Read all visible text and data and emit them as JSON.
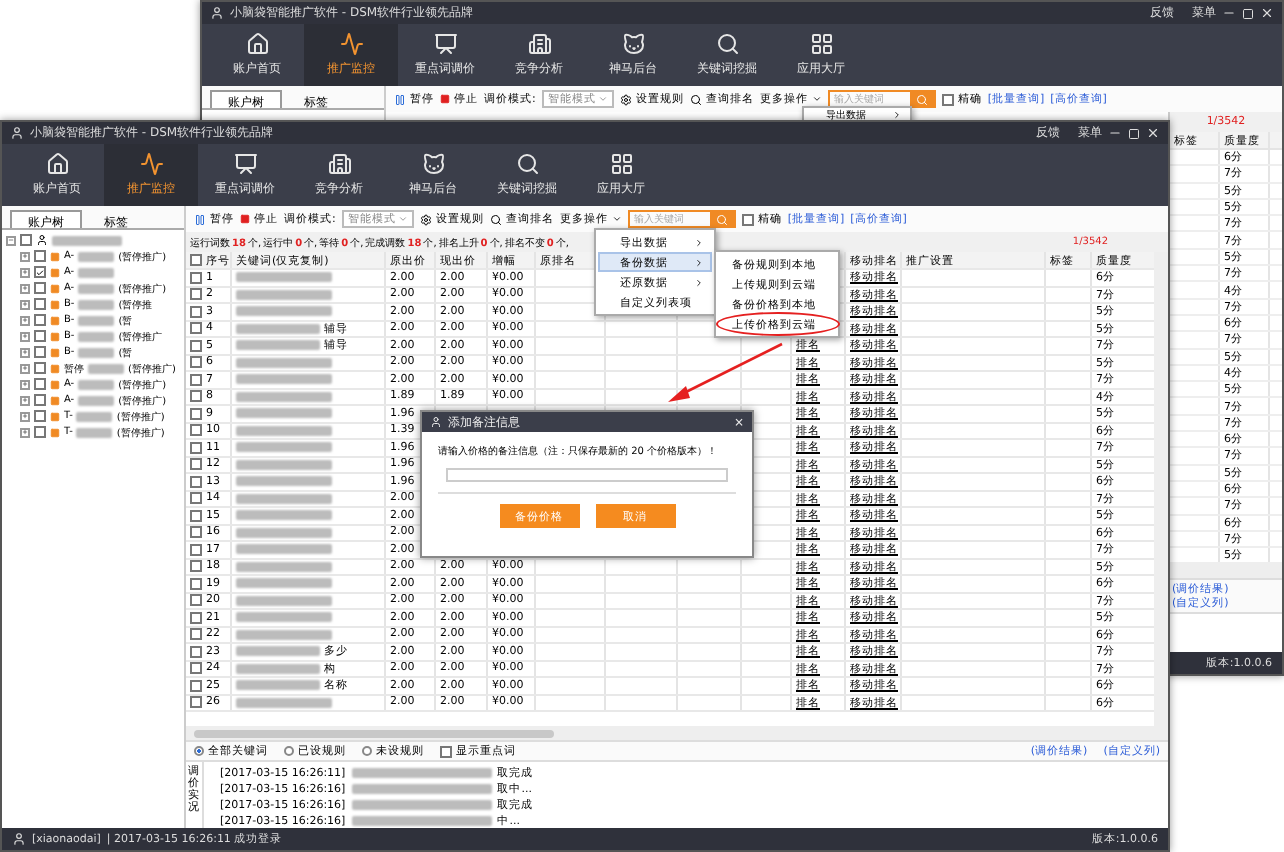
{
  "back_window": {
    "title": "小脑袋智能推广软件 - DSM软件行业领先品牌",
    "header_links": [
      "反馈",
      "菜单"
    ],
    "nav": [
      {
        "label": "账户首页",
        "selected": false
      },
      {
        "label": "推广监控",
        "selected": true
      },
      {
        "label": "重点词调价",
        "selected": false
      },
      {
        "label": "竞争分析",
        "selected": false
      },
      {
        "label": "神马后台",
        "selected": false
      },
      {
        "label": "关键词挖掘",
        "selected": false
      },
      {
        "label": "应用大厅",
        "selected": false
      }
    ],
    "tabs": [
      {
        "label": "账户树",
        "selected": true
      },
      {
        "label": "标签",
        "selected": false
      }
    ],
    "toolbar": {
      "pause": "暂停",
      "stop": "停止",
      "mode_label": "调价模式:",
      "mode": "智能模式",
      "rules": "设置规则",
      "query": "查询排名",
      "more": "更多操作",
      "search_placeholder": "输入关键词",
      "exact": {
        "label": "精确",
        "checked": false
      },
      "links": [
        "[批量查询]",
        "[高价查询]"
      ]
    },
    "menu_peek": "导出数据",
    "pager": "1/3542",
    "strip": {
      "columns": [
        "标签",
        "质量度"
      ],
      "values": [
        "6分",
        "7分",
        "5分",
        "5分",
        "7分",
        "7分",
        "5分",
        "7分",
        "4分",
        "7分",
        "6分",
        "7分",
        "5分",
        "4分",
        "5分",
        "7分",
        "7分",
        "6分",
        "7分",
        "5分",
        "6分",
        "7分",
        "6分",
        "7分",
        "5分"
      ]
    },
    "links": [
      "(调价结果)",
      "(自定义列)"
    ],
    "version": "版本:1.0.0.6"
  },
  "window": {
    "title": "小脑袋智能推广软件 - DSM软件行业领先品牌",
    "header_links": [
      "反馈",
      "菜单"
    ],
    "nav": [
      {
        "label": "账户首页",
        "selected": false
      },
      {
        "label": "推广监控",
        "selected": true
      },
      {
        "label": "重点词调价",
        "selected": false
      },
      {
        "label": "竞争分析",
        "selected": false
      },
      {
        "label": "神马后台",
        "selected": false
      },
      {
        "label": "关键词挖掘",
        "selected": false
      },
      {
        "label": "应用大厅",
        "selected": false
      }
    ],
    "tabs": [
      {
        "label": "账户树",
        "selected": true
      },
      {
        "label": "标签",
        "selected": false
      }
    ],
    "tree": {
      "expanded": true,
      "checked": false,
      "children": [
        {
          "prefix": "A-",
          "suffix": "(暂停推广)",
          "checked": false
        },
        {
          "prefix": "A-",
          "checked": true
        },
        {
          "prefix": "A-",
          "suffix": "(暂停推广)",
          "checked": false
        },
        {
          "prefix": "B-",
          "suffix": "(暂停推",
          "checked": false
        },
        {
          "prefix": "B-",
          "suffix": "(暂",
          "checked": false
        },
        {
          "prefix": "B-",
          "suffix": "(暂停推广",
          "checked": false
        },
        {
          "prefix": "B-",
          "suffix": "(暂",
          "checked": false
        },
        {
          "prefix": "暂停",
          "suffix": "(暂停推广)",
          "checked": false
        },
        {
          "prefix": "A-",
          "suffix": "(暂停推广)",
          "checked": false
        },
        {
          "prefix": "A-",
          "suffix": "(暂停推广)",
          "checked": false
        },
        {
          "prefix": "T-",
          "suffix": "(暂停推广)",
          "checked": false
        },
        {
          "prefix": "T-",
          "suffix": "(暂停推广)",
          "checked": false
        }
      ]
    },
    "toolbar": {
      "pause": "暂停",
      "stop": "停止",
      "mode_label": "调价模式:",
      "mode": "智能模式",
      "rules": "设置规则",
      "query": "查询排名",
      "more": "更多操作",
      "search_placeholder": "输入关键词",
      "exact": {
        "label": "精确",
        "checked": false
      },
      "links": [
        "[批量查询]",
        "[高价查询]"
      ]
    },
    "counts": [
      {
        "label": "运行词数",
        "value": "18",
        "unit": "个,"
      },
      {
        "label": "运行中",
        "value": "0",
        "unit": "个,"
      },
      {
        "label": "等待",
        "value": "0",
        "unit": "个,"
      },
      {
        "label": "完成调数",
        "value": "18",
        "unit": "个,"
      },
      {
        "label": "排名上升",
        "value": "0",
        "unit": "个,"
      },
      {
        "label": "排名不变",
        "value": "0",
        "unit": "个,"
      }
    ],
    "pager": "1/3542",
    "select_all": {
      "checked": false
    },
    "columns": [
      {
        "label": "序号"
      },
      {
        "label": "关键词(仅克复制)"
      },
      {
        "label": "原出价"
      },
      {
        "label": "现出价"
      },
      {
        "label": "增幅"
      },
      {
        "label": "原排名"
      },
      {},
      {},
      {},
      {},
      {
        "label": "移动排名"
      },
      {
        "label": "推广设置"
      },
      {
        "label": "标签"
      },
      {
        "label": "质量度"
      }
    ],
    "rows": [
      {
        "no": "1",
        "old": "2.00",
        "new": "2.00",
        "change": "¥0.00",
        "mobile": "移动排名",
        "quality": "6分",
        "checked": false
      },
      {
        "no": "2",
        "old": "2.00",
        "new": "2.00",
        "change": "¥0.00",
        "mobile": "移动排名",
        "quality": "7分",
        "checked": false
      },
      {
        "no": "3",
        "old": "2.00",
        "new": "2.00",
        "change": "¥0.00",
        "mobile": "移动排名",
        "quality": "5分",
        "checked": false
      },
      {
        "no": "4",
        "keyword": "辅导",
        "old": "2.00",
        "new": "2.00",
        "change": "¥0.00",
        "mobile": "移动排名",
        "quality": "5分",
        "checked": false
      },
      {
        "no": "5",
        "keyword": "辅导",
        "old": "2.00",
        "new": "2.00",
        "change": "¥0.00",
        "rank": "排名",
        "mobile": "移动排名",
        "quality": "7分",
        "checked": false
      },
      {
        "no": "6",
        "old": "2.00",
        "new": "2.00",
        "change": "¥0.00",
        "rank": "排名",
        "mobile": "移动排名",
        "quality": "5分",
        "checked": false
      },
      {
        "no": "7",
        "old": "2.00",
        "new": "2.00",
        "change": "¥0.00",
        "rank": "排名",
        "mobile": "移动排名",
        "quality": "7分",
        "checked": false
      },
      {
        "no": "8",
        "old": "1.89",
        "new": "1.89",
        "change": "¥0.00",
        "rank": "排名",
        "mobile": "移动排名",
        "quality": "4分",
        "checked": false
      },
      {
        "no": "9",
        "old": "1.96",
        "rank": "排名",
        "mobile": "移动排名",
        "quality": "5分",
        "checked": false
      },
      {
        "no": "10",
        "old": "1.39",
        "rank": "排名",
        "mobile": "移动排名",
        "quality": "6分",
        "checked": false
      },
      {
        "no": "11",
        "old": "1.96",
        "rank": "排名",
        "mobile": "移动排名",
        "quality": "7分",
        "checked": false
      },
      {
        "no": "12",
        "old": "1.96",
        "rank": "排名",
        "mobile": "移动排名",
        "quality": "5分",
        "checked": false
      },
      {
        "no": "13",
        "old": "1.96",
        "rank": "排名",
        "mobile": "移动排名",
        "quality": "6分",
        "checked": false
      },
      {
        "no": "14",
        "old": "2.00",
        "rank": "排名",
        "mobile": "移动排名",
        "quality": "7分",
        "checked": false
      },
      {
        "no": "15",
        "old": "2.00",
        "rank": "排名",
        "mobile": "移动排名",
        "quality": "5分",
        "checked": false
      },
      {
        "no": "16",
        "old": "2.00",
        "rank": "排名",
        "mobile": "移动排名",
        "quality": "6分",
        "checked": false
      },
      {
        "no": "17",
        "old": "2.00",
        "rank": "排名",
        "mobile": "移动排名",
        "quality": "7分",
        "checked": false
      },
      {
        "no": "18",
        "old": "2.00",
        "new": "2.00",
        "change": "¥0.00",
        "rank": "排名",
        "mobile": "移动排名",
        "quality": "5分",
        "checked": false
      },
      {
        "no": "19",
        "old": "2.00",
        "new": "2.00",
        "change": "¥0.00",
        "rank": "排名",
        "mobile": "移动排名",
        "quality": "6分",
        "checked": false
      },
      {
        "no": "20",
        "old": "2.00",
        "new": "2.00",
        "change": "¥0.00",
        "rank": "排名",
        "mobile": "移动排名",
        "quality": "7分",
        "checked": false
      },
      {
        "no": "21",
        "old": "2.00",
        "new": "2.00",
        "change": "¥0.00",
        "rank": "排名",
        "mobile": "移动排名",
        "quality": "5分",
        "checked": false
      },
      {
        "no": "22",
        "old": "2.00",
        "new": "2.00",
        "change": "¥0.00",
        "rank": "排名",
        "mobile": "移动排名",
        "quality": "6分",
        "checked": false
      },
      {
        "no": "23",
        "keyword": "多少",
        "old": "2.00",
        "new": "2.00",
        "change": "¥0.00",
        "rank": "排名",
        "mobile": "移动排名",
        "quality": "7分",
        "checked": false
      },
      {
        "no": "24",
        "keyword": "构",
        "old": "2.00",
        "new": "2.00",
        "change": "¥0.00",
        "rank": "排名",
        "mobile": "移动排名",
        "quality": "7分",
        "checked": false
      },
      {
        "no": "25",
        "keyword": "名称",
        "old": "2.00",
        "new": "2.00",
        "change": "¥0.00",
        "rank": "排名",
        "mobile": "移动排名",
        "quality": "6分",
        "checked": false
      },
      {
        "no": "26",
        "old": "2.00",
        "new": "2.00",
        "change": "¥0.00",
        "rank": "排名",
        "mobile": "移动排名",
        "quality": "6分",
        "checked": false
      }
    ],
    "filters": [
      {
        "label": "全部关键词",
        "kind": "radio",
        "selected": true
      },
      {
        "label": "已设规则",
        "kind": "radio",
        "selected": false
      },
      {
        "label": "未设规则",
        "kind": "radio",
        "selected": false
      },
      {
        "label": "显示重点词",
        "kind": "checkbox",
        "selected": false
      }
    ],
    "result_links": [
      "(调价结果)",
      "(自定义列)"
    ],
    "log_label": "调价实况",
    "log": [
      {
        "time": "[2017-03-15 16:26:11]",
        "text": "取完成"
      },
      {
        "time": "[2017-03-15 16:26:16]",
        "text": "取中..."
      },
      {
        "time": "[2017-03-15 16:26:16]",
        "text": "取完成"
      },
      {
        "time": "[2017-03-15 16:26:16]",
        "text": "中..."
      }
    ],
    "status": {
      "user": "[xiaonaodai]",
      "message": "| 2017-03-15 16:26:11 成功登录",
      "version": "版本:1.0.0.6"
    },
    "menu": [
      {
        "label": "导出数据",
        "submenu": true,
        "selected": false
      },
      {
        "label": "备份数据",
        "submenu": true,
        "selected": true
      },
      {
        "label": "还原数据",
        "submenu": true,
        "selected": false
      },
      {
        "label": "自定义列表项",
        "submenu": false,
        "selected": false
      }
    ],
    "submenu": [
      {
        "label": "备份规则到本地",
        "circled": false
      },
      {
        "label": "上传规则到云端",
        "circled": false
      },
      {
        "label": "备份价格到本地",
        "circled": false
      },
      {
        "label": "上传价格到云端",
        "circled": true
      }
    ],
    "dialog": {
      "title": "添加备注信息",
      "close": "×",
      "message": "请输入价格的备注信息（注：只保存最新的 20 个价格版本）！",
      "buttons": [
        "备份价格",
        "取消"
      ]
    }
  }
}
